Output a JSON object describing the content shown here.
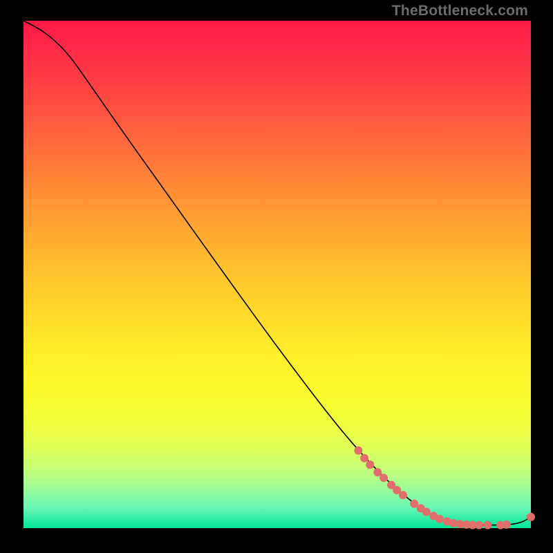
{
  "watermark": "TheBottleneck.com",
  "chart_data": {
    "type": "line",
    "title": "",
    "xlabel": "",
    "ylabel": "",
    "xlim": [
      0,
      100
    ],
    "ylim": [
      0,
      100
    ],
    "curve": [
      {
        "x": 0,
        "y": 100
      },
      {
        "x": 3,
        "y": 98.5
      },
      {
        "x": 6,
        "y": 96.3
      },
      {
        "x": 9,
        "y": 93.2
      },
      {
        "x": 12,
        "y": 89.0
      },
      {
        "x": 20,
        "y": 77.5
      },
      {
        "x": 30,
        "y": 63.5
      },
      {
        "x": 40,
        "y": 49.5
      },
      {
        "x": 50,
        "y": 35.7
      },
      {
        "x": 60,
        "y": 22.5
      },
      {
        "x": 66,
        "y": 15.3
      },
      {
        "x": 72,
        "y": 9.0
      },
      {
        "x": 78,
        "y": 4.0
      },
      {
        "x": 82,
        "y": 1.8
      },
      {
        "x": 85,
        "y": 0.9
      },
      {
        "x": 90,
        "y": 0.6
      },
      {
        "x": 95,
        "y": 0.6
      },
      {
        "x": 98,
        "y": 1.0
      },
      {
        "x": 100,
        "y": 2.2
      }
    ],
    "markers": [
      {
        "x": 66.0,
        "y": 15.3
      },
      {
        "x": 67.2,
        "y": 13.8
      },
      {
        "x": 68.3,
        "y": 12.5
      },
      {
        "x": 69.8,
        "y": 11.0
      },
      {
        "x": 71.0,
        "y": 9.9
      },
      {
        "x": 72.5,
        "y": 8.5
      },
      {
        "x": 73.6,
        "y": 7.5
      },
      {
        "x": 74.8,
        "y": 6.5
      },
      {
        "x": 77.0,
        "y": 4.8
      },
      {
        "x": 78.3,
        "y": 3.9
      },
      {
        "x": 79.4,
        "y": 3.2
      },
      {
        "x": 80.8,
        "y": 2.4
      },
      {
        "x": 82.0,
        "y": 1.8
      },
      {
        "x": 83.5,
        "y": 1.3
      },
      {
        "x": 84.7,
        "y": 1.0
      },
      {
        "x": 86.0,
        "y": 0.8
      },
      {
        "x": 87.3,
        "y": 0.7
      },
      {
        "x": 88.5,
        "y": 0.6
      },
      {
        "x": 89.8,
        "y": 0.6
      },
      {
        "x": 91.5,
        "y": 0.6
      },
      {
        "x": 94.0,
        "y": 0.6
      },
      {
        "x": 95.2,
        "y": 0.7
      },
      {
        "x": 100.0,
        "y": 2.2
      }
    ],
    "marker_radius_px": 6,
    "colors": {
      "curve": "#000000",
      "marker": "#e06e6b",
      "gradient_top": "#ff1846",
      "gradient_bottom": "#00e69a"
    }
  }
}
